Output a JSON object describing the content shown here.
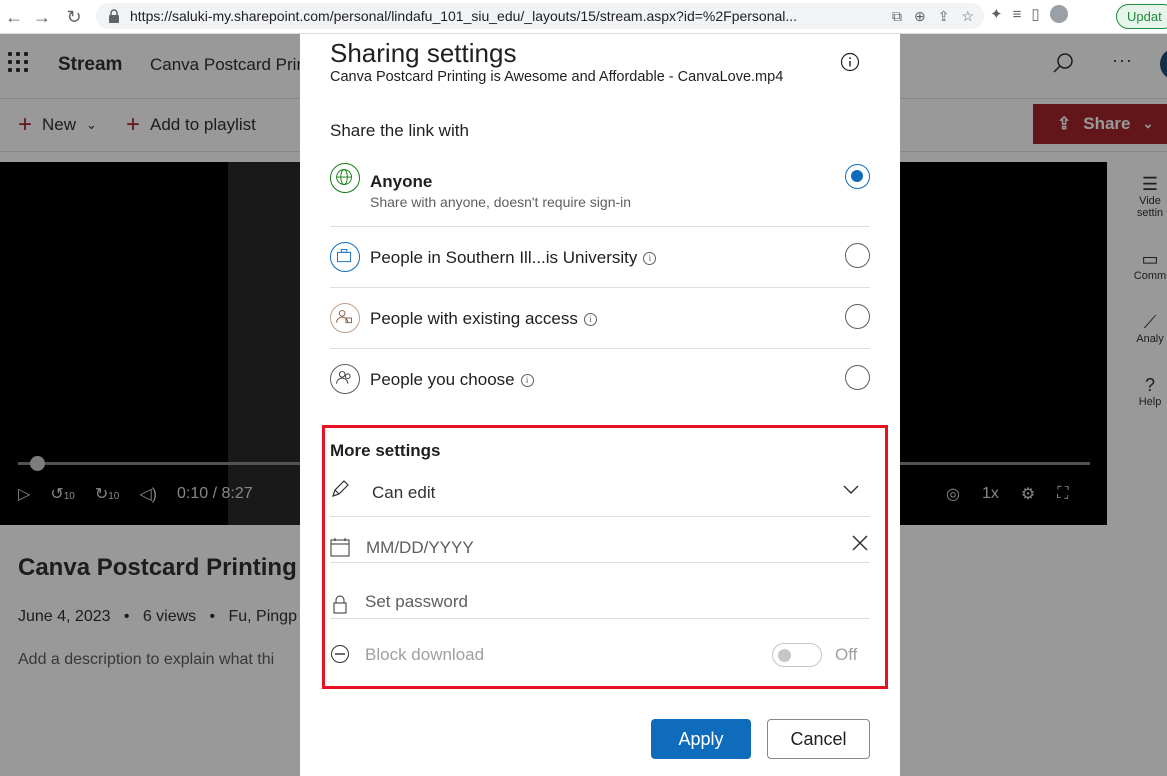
{
  "browser": {
    "url": "https://saluki-my.sharepoint.com/personal/lindafu_101_siu_edu/_layouts/15/stream.aspx?id=%2Fpersonal...",
    "update_label": "Updat"
  },
  "app": {
    "name": "Stream",
    "doc_name": "Canva Postcard Prin",
    "commands": {
      "new_label": "New",
      "add_playlist_label": "Add to playlist",
      "share_label": "Share"
    },
    "player": {
      "time": "0:10 / 8:27",
      "speed": "1x",
      "skip": "10",
      "progress": 0.01
    },
    "rail": {
      "video_settings": "Vide settin",
      "comments": "Comm",
      "analytics": "Analy",
      "help": "Help"
    },
    "video_title": "Canva Postcard Printing i",
    "meta": {
      "date": "June 4, 2023",
      "views": "6 views",
      "owner": "Fu, Pingp",
      "sep": "•"
    },
    "description": "Add a description to explain what thi"
  },
  "dialog": {
    "title": "Sharing settings",
    "file_name": "Canva Postcard Printing is Awesome and Affordable - CanvaLove.mp4",
    "section_label": "Share the link with",
    "options": [
      {
        "label": "Anyone",
        "sub": "Share with anyone, doesn't require sign-in",
        "selected": true,
        "icon": "globe-icon"
      },
      {
        "label": "People in Southern Ill...is University",
        "selected": false,
        "icon": "briefcase-icon"
      },
      {
        "label": "People with existing access",
        "selected": false,
        "icon": "people-lock-icon"
      },
      {
        "label": "People you choose",
        "selected": false,
        "icon": "people-icon"
      }
    ],
    "more_settings": {
      "title": "More settings",
      "permission": "Can edit",
      "date_placeholder": "MM/DD/YYYY",
      "password_placeholder": "Set password",
      "block_download": "Block download",
      "toggle_state": "Off"
    },
    "apply_label": "Apply",
    "cancel_label": "Cancel"
  },
  "colors": {
    "brand": "#a4262c",
    "primary": "#0f6cbd",
    "highlight": "#e81123"
  }
}
